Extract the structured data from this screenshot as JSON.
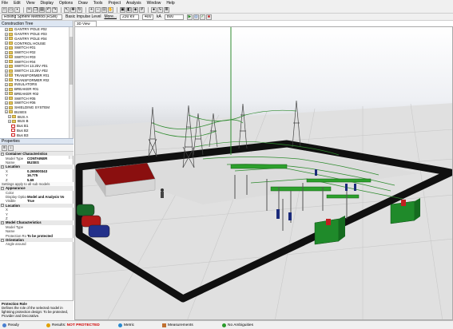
{
  "menu": [
    "File",
    "Edit",
    "View",
    "Display",
    "Options",
    "Draw",
    "Tools",
    "Project",
    "Analysis",
    "Window",
    "Help"
  ],
  "toolbar2": {
    "method": "Rolling Sphere Method (RSM)",
    "impulse": "Basic Impulse Level",
    "more": "More...",
    "kv": "230 kV",
    "val1": "400",
    "unit1": "kA",
    "val2": "800"
  },
  "tree": {
    "title": "Construction Tree",
    "items": [
      {
        "label": "GANTRY POLE #02",
        "type": "folder",
        "indent": 1
      },
      {
        "label": "GANTRY POLE #03",
        "type": "folder",
        "indent": 1
      },
      {
        "label": "GANTRY POLE #04",
        "type": "folder",
        "indent": 1
      },
      {
        "label": "CONTROL HOUSE",
        "type": "folder",
        "indent": 1
      },
      {
        "label": "SWITCH #01",
        "type": "folder",
        "indent": 1
      },
      {
        "label": "SWITCH #02",
        "type": "folder",
        "indent": 1
      },
      {
        "label": "SWITCH #03",
        "type": "folder",
        "indent": 1
      },
      {
        "label": "SWITCH #04",
        "type": "folder",
        "indent": 1
      },
      {
        "label": "SWITCH 13.2kV #01",
        "type": "folder",
        "indent": 1
      },
      {
        "label": "SWITCH 13.2kV #02",
        "type": "folder",
        "indent": 1
      },
      {
        "label": "TRANSFORMER #01",
        "type": "folder",
        "indent": 1
      },
      {
        "label": "TRANSFORMER #02",
        "type": "folder",
        "indent": 1
      },
      {
        "label": "INSULATORS",
        "type": "folder",
        "indent": 1
      },
      {
        "label": "BREAKER #01",
        "type": "folder",
        "indent": 1
      },
      {
        "label": "BREAKER #02",
        "type": "folder",
        "indent": 1
      },
      {
        "label": "SWITCH #05",
        "type": "folder",
        "indent": 1
      },
      {
        "label": "SWITCH #06",
        "type": "folder",
        "indent": 1
      },
      {
        "label": "SHIELDING SYSTEM",
        "type": "folder",
        "indent": 1
      },
      {
        "label": "BUSES",
        "type": "folder",
        "indent": 1
      },
      {
        "label": "BUS A",
        "type": "folder",
        "indent": 2
      },
      {
        "label": "BUS B",
        "type": "folder",
        "indent": 2
      },
      {
        "label": "Bus B1",
        "type": "bus",
        "indent": 3
      },
      {
        "label": "Bus B2",
        "type": "bus",
        "indent": 3
      },
      {
        "label": "Bus B3",
        "type": "bus",
        "indent": 3
      },
      {
        "label": "Bus B4",
        "type": "bus",
        "indent": 3
      },
      {
        "label": "Bus B5",
        "type": "bus",
        "indent": 3
      },
      {
        "label": "Bus B6",
        "type": "bus",
        "indent": 3
      }
    ]
  },
  "properties": {
    "title": "Properties",
    "rows": [
      {
        "kind": "cat",
        "k": "Container Characteristics"
      },
      {
        "kind": "row",
        "k": "Model Type",
        "v": "CONTAINER"
      },
      {
        "kind": "row",
        "k": "Name",
        "v": "BUSES"
      },
      {
        "kind": "cat",
        "k": "Location"
      },
      {
        "kind": "row",
        "k": "X",
        "v": "0.265000343"
      },
      {
        "kind": "row",
        "k": "Y",
        "v": "16.775"
      },
      {
        "kind": "row",
        "k": "Z",
        "v": "5.69"
      },
      {
        "kind": "note",
        "k": "Settings apply to all sub models"
      },
      {
        "kind": "cat",
        "k": "Appearance"
      },
      {
        "kind": "row",
        "k": "Color",
        "v": ""
      },
      {
        "kind": "row",
        "k": "Display Option",
        "v": "Model and Analysis Vo"
      },
      {
        "kind": "row",
        "k": "Visible",
        "v": "True"
      },
      {
        "kind": "cat",
        "k": "Location"
      },
      {
        "kind": "row",
        "k": "X",
        "v": ""
      },
      {
        "kind": "row",
        "k": "Y",
        "v": ""
      },
      {
        "kind": "row",
        "k": "Z",
        "v": ""
      },
      {
        "kind": "cat",
        "k": "Model Characteristics"
      },
      {
        "kind": "row",
        "k": "Model Type",
        "v": ""
      },
      {
        "kind": "row",
        "k": "Name",
        "v": ""
      },
      {
        "kind": "row",
        "k": "Protection Role",
        "v": "To be protected"
      },
      {
        "kind": "cat",
        "k": "Orientation"
      },
      {
        "kind": "row",
        "k": "Angle around Z",
        "v": ""
      }
    ],
    "desc_title": "Protection Role",
    "desc_text": "Defines the role of the selected model in lightning protection design: To be protected, Provider and Decorative."
  },
  "view": {
    "tab": "3D View"
  },
  "status": {
    "ready": "Ready",
    "results_label": "Results:",
    "results_value": "NOT PROTECTED",
    "metric": "Metric",
    "measurements": "Measurements",
    "ambiguities": "No Ambiguities"
  }
}
